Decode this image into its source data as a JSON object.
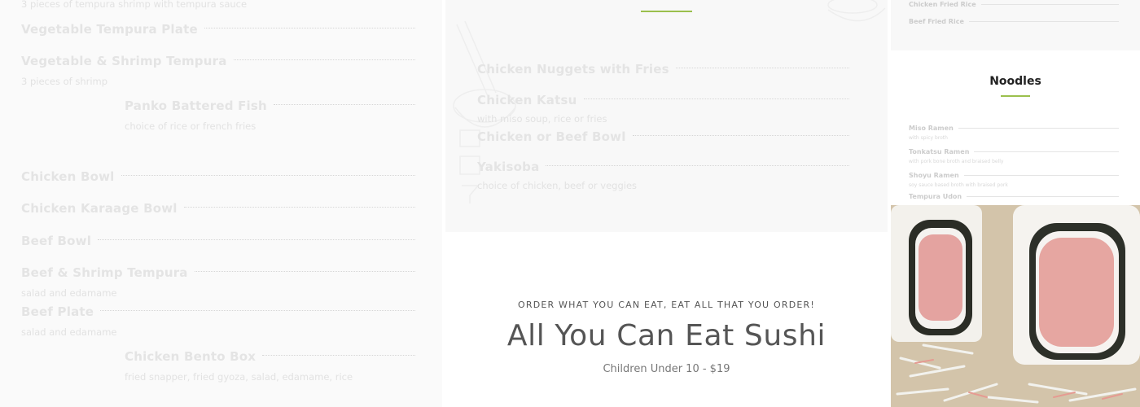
{
  "left_menu": {
    "partial_top_desc": "3 pieces of tempura shrimp with tempura sauce",
    "items": [
      {
        "name": "Vegetable Tempura Plate",
        "desc": ""
      },
      {
        "name": "Vegetable & Shrimp Tempura",
        "desc": "3 pieces of shrimp"
      },
      {
        "name": "Panko Battered Fish",
        "desc": "choice of rice or french fries"
      },
      {
        "name": "Chicken Bowl",
        "desc": ""
      },
      {
        "name": "Chicken Karaage Bowl",
        "desc": ""
      },
      {
        "name": "Beef Bowl",
        "desc": ""
      },
      {
        "name": "Beef & Shrimp Tempura",
        "desc": "salad and edamame"
      },
      {
        "name": "Beef Plate",
        "desc": "salad and edamame"
      },
      {
        "name": "Chicken Bento Box",
        "desc": "fried snapper, fried gyoza, salad, edamame, rice"
      }
    ]
  },
  "kids_menu": {
    "items": [
      {
        "name": "Chicken Nuggets with Fries",
        "desc": ""
      },
      {
        "name": "Chicken Katsu",
        "desc": "with miso soup, rice or fries"
      },
      {
        "name": "Chicken or Beef Bowl",
        "desc": ""
      },
      {
        "name": "Yakisoba",
        "desc": "choice of chicken, beef or veggies"
      }
    ]
  },
  "promo": {
    "tagline": "ORDER WHAT YOU CAN EAT, EAT ALL THAT YOU ORDER!",
    "title": "All You Can Eat Sushi",
    "subtitle": "Children Under 10 - $19"
  },
  "rice_menu": {
    "items": [
      {
        "name": "Chicken Fried Rice"
      },
      {
        "name": "Beef Fried Rice"
      }
    ]
  },
  "noodles": {
    "title": "Noodles",
    "items": [
      {
        "name": "Miso Ramen",
        "desc": "with spicy broth"
      },
      {
        "name": "Tonkatsu Ramen",
        "desc": "with pork bone broth and braised belly"
      },
      {
        "name": "Shoyu Ramen",
        "desc": "soy sauce based broth with braised pork"
      },
      {
        "name": "Tempura Udon",
        "desc": ""
      }
    ]
  },
  "image": {
    "subject": "california-roll-sushi-photo"
  },
  "colors": {
    "accent": "#9bc04d",
    "heading": "#555555"
  }
}
